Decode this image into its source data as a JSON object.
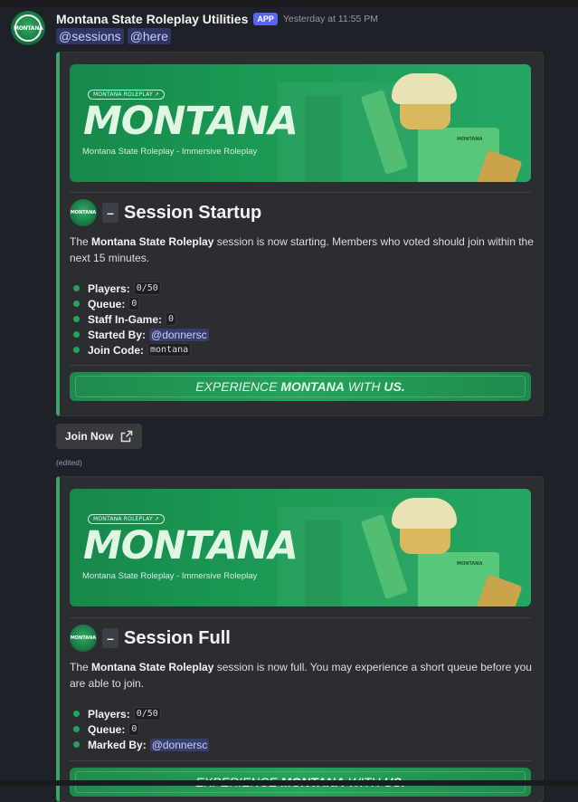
{
  "message": {
    "username": "Montana State Roleplay Utilities",
    "app_badge": "APP",
    "timestamp": "Yesterday at 11:55 PM",
    "mentions": [
      "@sessions",
      "@here"
    ],
    "avatar_text": "MONTANA",
    "edited": "(edited)"
  },
  "banner": {
    "tag": "MONTANA ROLEPLAY ↗",
    "big_text": "MONTANA",
    "subtitle": "Montana State Roleplay - Immersive Roleplay",
    "shirt_text": "MONTANA"
  },
  "embeds": [
    {
      "title": "Session Startup",
      "dash": "–",
      "desc_prefix": "The ",
      "desc_bold": "Montana State Roleplay",
      "desc_rest": " session is now starting. Members who voted should join within the next 15 minutes.",
      "items": [
        {
          "label": "Players:",
          "value": "0/50",
          "type": "code"
        },
        {
          "label": "Queue:",
          "value": "0",
          "type": "code"
        },
        {
          "label": "Staff In-Game:",
          "value": "0",
          "type": "code"
        },
        {
          "label": "Started By:",
          "value": "@donnersc",
          "type": "mention"
        },
        {
          "label": "Join Code:",
          "value": "montana",
          "type": "code"
        }
      ],
      "footer_prefix": "EXPERIENCE ",
      "footer_bold": "MONTANA",
      "footer_mid": " WITH ",
      "footer_end": "US."
    },
    {
      "title": "Session Full",
      "dash": "–",
      "desc_prefix": "The ",
      "desc_bold": "Montana State Roleplay",
      "desc_rest": " session is now full. You may experience a short queue before you are able to join.",
      "items": [
        {
          "label": "Players:",
          "value": "0/50",
          "type": "code"
        },
        {
          "label": "Queue:",
          "value": "0",
          "type": "code"
        },
        {
          "label": "Marked By:",
          "value": "@donnersc",
          "type": "mention"
        }
      ],
      "footer_prefix": "EXPERIENCE ",
      "footer_bold": "MONTANA",
      "footer_mid": " WITH ",
      "footer_end": "US."
    }
  ],
  "join_button": {
    "label": "Join Now",
    "icon": "external-link-icon"
  },
  "colors": {
    "accent": "#3aa761",
    "app_badge": "#5865f2",
    "bullet": "#23a559"
  }
}
